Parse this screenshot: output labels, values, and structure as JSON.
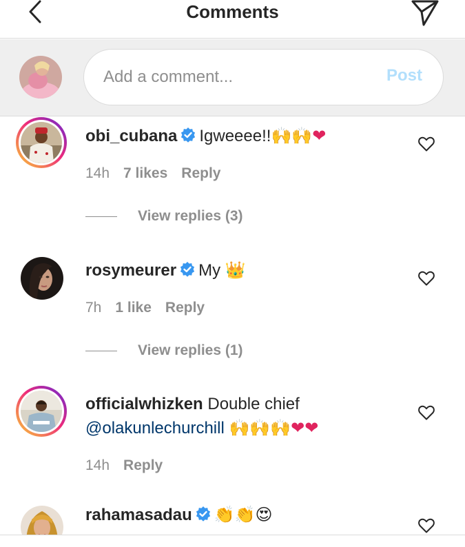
{
  "header": {
    "title": "Comments",
    "back_icon": "chevron-left-icon",
    "send_icon": "direct-send-icon"
  },
  "composer": {
    "placeholder": "Add a comment...",
    "value": "",
    "post_label": "Post",
    "post_color": "#b2dffc"
  },
  "comments": [
    {
      "username": "obi_cubana",
      "verified": true,
      "text": "Igweeee!!",
      "emojis": "🙌🙌",
      "heart": "❤",
      "time": "14h",
      "likes": "7 likes",
      "reply_label": "Reply",
      "view_replies": "View replies (3)",
      "has_story": true
    },
    {
      "username": "rosymeurer",
      "verified": true,
      "text": "My",
      "emojis": "👑",
      "time": "7h",
      "likes": "1 like",
      "reply_label": "Reply",
      "view_replies": "View replies (1)",
      "has_story": false
    },
    {
      "username": "officialwhizken",
      "verified": false,
      "text": "Double chief",
      "mention": "@olakunlechurchill",
      "emojis": "🙌🙌🙌",
      "hearts": "❤❤",
      "time": "14h",
      "reply_label": "Reply",
      "has_story": true
    },
    {
      "username": "rahamasadau",
      "verified": true,
      "emojis": "👏👏😍",
      "has_story": false
    }
  ],
  "colors": {
    "verified_blue": "#3897f0",
    "heart_pink": "#e0245e",
    "meta_gray": "#8e8e8e",
    "mention_blue": "#00376b"
  }
}
